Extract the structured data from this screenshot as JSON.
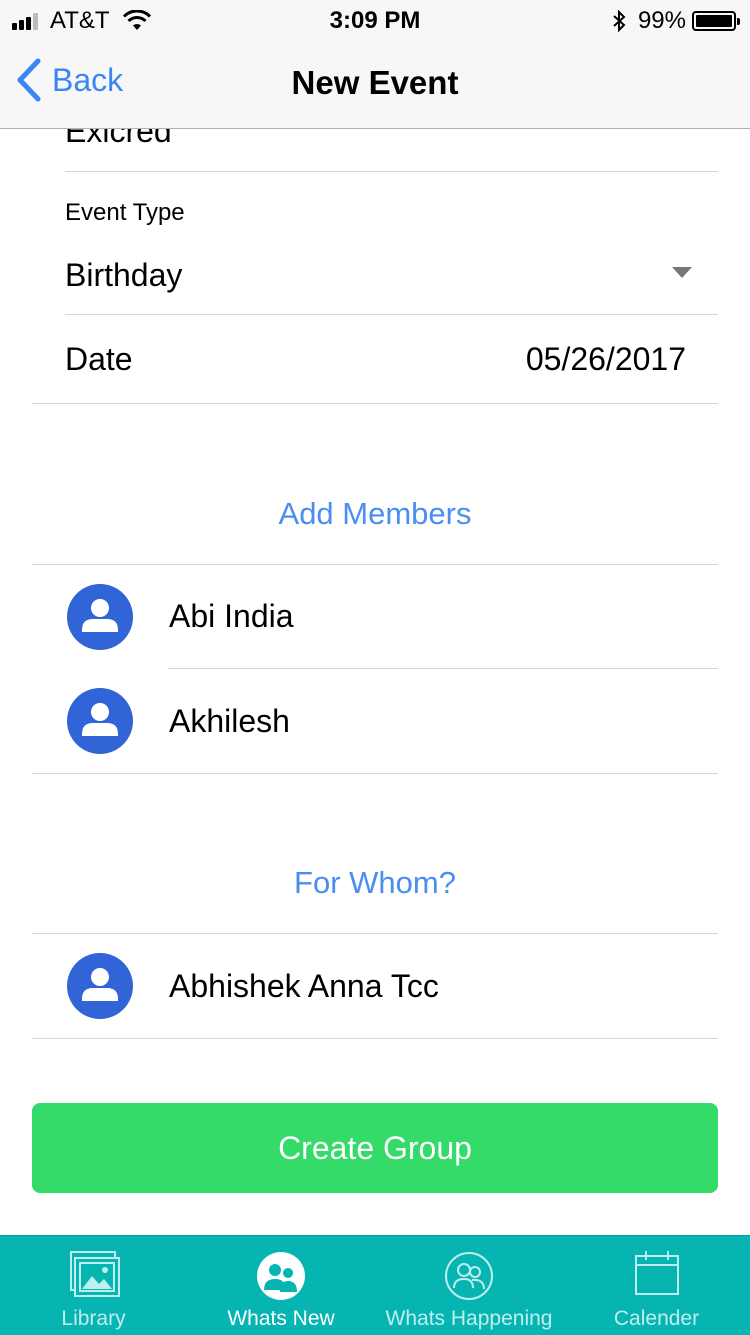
{
  "status_bar": {
    "carrier": "AT&T",
    "time": "3:09 PM",
    "battery_percent": "99%",
    "battery_level": 0.99
  },
  "nav": {
    "back_label": "Back",
    "title": "New Event"
  },
  "form": {
    "event_name_value": "Exicred",
    "event_type_label": "Event Type",
    "event_type_value": "Birthday",
    "date_label": "Date",
    "date_value": "05/26/2017"
  },
  "add_members": {
    "link_label": "Add Members",
    "members": [
      {
        "name": "Abi India"
      },
      {
        "name": "Akhilesh"
      }
    ]
  },
  "for_whom": {
    "link_label": "For Whom?",
    "members": [
      {
        "name": "Abhishek Anna Tcc"
      }
    ]
  },
  "create_button_label": "Create Group",
  "tab_bar": {
    "tabs": [
      {
        "label": "Library",
        "icon": "library-icon",
        "active": false
      },
      {
        "label": "Whats New",
        "icon": "whats-new-icon",
        "active": true
      },
      {
        "label": "Whats Happening",
        "icon": "whats-happening-icon",
        "active": false
      },
      {
        "label": "Calender",
        "icon": "calendar-icon",
        "active": false
      }
    ]
  },
  "colors": {
    "accent_blue": "#3b85f5",
    "create_green": "#34db68",
    "tab_bar_teal": "#06b5b2",
    "avatar_blue": "#3164d6"
  }
}
